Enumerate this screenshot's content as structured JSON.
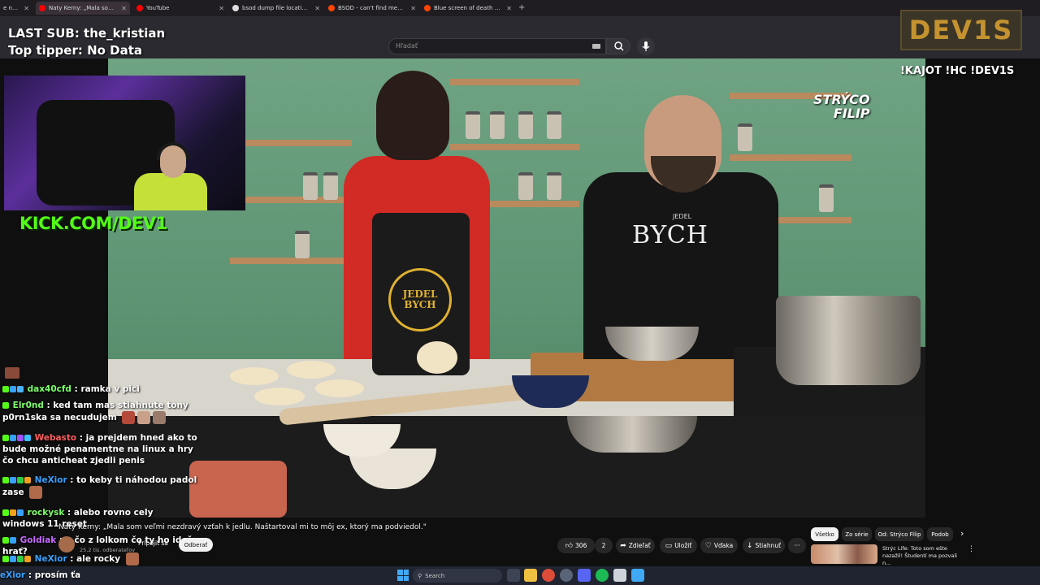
{
  "browser": {
    "tabs": [
      {
        "title": "e nazaží",
        "favicon_color": "#c62828",
        "active": false
      },
      {
        "title": "Naty Kerny: „Mala som veľmi ne",
        "favicon_color": "#ff0000",
        "active": true
      },
      {
        "title": "YouTube",
        "favicon_color": "#ff0000",
        "active": false
      },
      {
        "title": "bsod dump file location - Goog",
        "favicon_color": "#e0e0e0",
        "active": false
      },
      {
        "title": "BSOD - can't find memory dum",
        "favicon_color": "#ff4500",
        "active": false
      },
      {
        "title": "Blue screen of death fix - LEAG",
        "favicon_color": "#ff4500",
        "active": false
      }
    ],
    "new_tab": "+"
  },
  "youtube": {
    "search_placeholder": "Hľadať",
    "video_title": "Naty Kerny: „Mala som veľmi nezdravý vzťah k jedlu. Naštartoval mi to môj ex, ktorý ma podviedol.\"",
    "channel_subs": "25,2 tis. odberateľov",
    "join_label": "Pripojiť sa",
    "subscribe_label": "Odberať",
    "likes": "306",
    "comments": "2",
    "share_label": "Zdieľať",
    "save_label": "Uložiť",
    "thanks_label": "Vďaka",
    "download_label": "Stiahnuť",
    "more_label": "···",
    "chips": [
      "Všetko",
      "Zo série",
      "Od: Strýco Filip",
      "Podob"
    ],
    "rec_title": "Strýc Life: Toto som ešte nazažil! Študentí ma pozvali n..."
  },
  "overlay": {
    "last_sub": "LAST SUB: the_kristian",
    "top_tipper": "Top tipper: No Data",
    "logo": "DEV1S",
    "commands": "!KAJOT !HC !DEV1S",
    "kick": "KICK.COM/DEV1",
    "show_brand_line1": "STRÝCO",
    "show_brand_line2": "FILIP",
    "shirt_big": "BYCH",
    "shirt_small": "JEDEL",
    "apron_line1": "JEDEL",
    "apron_line2": "BYCH"
  },
  "chat": [
    {
      "user": "dax40cfd",
      "color": "#7dff6a",
      "text": "ramka v pici"
    },
    {
      "user": "Elr0nd",
      "color": "#7dff6a",
      "text": "ked tam mas stiahnute tony p0rn1ska sa necudujem"
    },
    {
      "user": "Webasto",
      "color": "#ff5d5d",
      "text": "ja prejdem hned ako to bude možné penamentne na linux a hry čo chcu anticheat zjedli penis"
    },
    {
      "user": "NeXior",
      "color": "#39a0ff",
      "text": "to keby ti náhodou padol zase"
    },
    {
      "user": "rockysk",
      "color": "#7dff6a",
      "text": "alebo rovno cely windows 11 reset"
    },
    {
      "user": "Goldiak",
      "color": "#c86bff",
      "text": "a čo z lolkom čo ty ho ideš hrať?"
    },
    {
      "user": "NeXior",
      "color": "#39a0ff",
      "text": "ale rocky"
    }
  ],
  "chat_input": {
    "user": "eXior",
    "text": "prosím ťa"
  },
  "taskbar": {
    "search_label": "Search"
  },
  "colors": {
    "kick_green": "#53fc18",
    "logo_gold": "#c4922f",
    "apron_gold": "#e0b230"
  }
}
